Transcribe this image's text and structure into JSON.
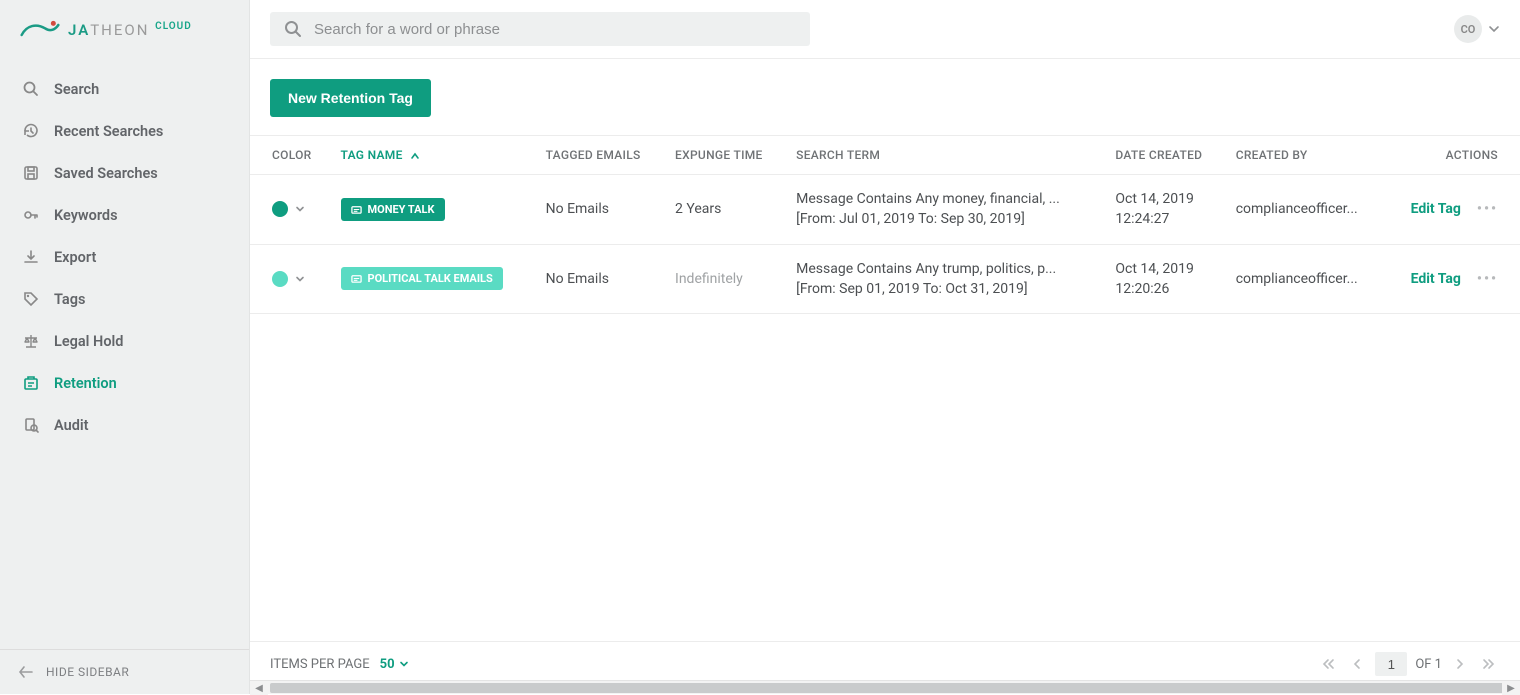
{
  "brand": {
    "name1": "JA",
    "name2": "THEON",
    "cloud": "CLOUD"
  },
  "user": {
    "initials": "CO"
  },
  "search": {
    "placeholder": "Search for a word or phrase"
  },
  "sidebar": {
    "items": [
      {
        "label": "Search",
        "icon": "search"
      },
      {
        "label": "Recent Searches",
        "icon": "history"
      },
      {
        "label": "Saved Searches",
        "icon": "save"
      },
      {
        "label": "Keywords",
        "icon": "key"
      },
      {
        "label": "Export",
        "icon": "download"
      },
      {
        "label": "Tags",
        "icon": "tag"
      },
      {
        "label": "Legal Hold",
        "icon": "balance"
      },
      {
        "label": "Retention",
        "icon": "retention",
        "active": true
      },
      {
        "label": "Audit",
        "icon": "audit"
      }
    ],
    "hide_label": "HIDE SIDEBAR"
  },
  "buttons": {
    "new_tag": "New Retention Tag"
  },
  "table": {
    "headers": {
      "color": "COLOR",
      "tag_name": "TAG NAME",
      "tagged_emails": "TAGGED EMAILS",
      "expunge_time": "EXPUNGE TIME",
      "search_term": "SEARCH TERM",
      "date_created": "DATE CREATED",
      "created_by": "CREATED BY",
      "actions": "ACTIONS"
    },
    "rows": [
      {
        "color": "#0f9d80",
        "tag_label": "MONEY TALK",
        "tag_bg": "#0f9d80",
        "tagged_emails": "No Emails",
        "expunge_time": "2 Years",
        "expunge_muted": false,
        "search_line1": "Message Contains Any money, financial, ...",
        "search_line2": "[From: Jul 01, 2019 To: Sep 30, 2019]",
        "date_line1": "Oct 14, 2019",
        "date_line2": "12:24:27",
        "created_by": "complianceofficer...",
        "edit_label": "Edit Tag"
      },
      {
        "color": "#5adbc3",
        "tag_label": "POLITICAL TALK EMAILS",
        "tag_bg": "#5adbc3",
        "tagged_emails": "No Emails",
        "expunge_time": "Indefinitely",
        "expunge_muted": true,
        "search_line1": "Message Contains Any trump, politics, p...",
        "search_line2": "[From: Sep 01, 2019 To: Oct 31, 2019]",
        "date_line1": "Oct 14, 2019",
        "date_line2": "12:20:26",
        "created_by": "complianceofficer...",
        "edit_label": "Edit Tag"
      }
    ]
  },
  "pagination": {
    "items_label": "ITEMS PER PAGE",
    "items_value": "50",
    "page": "1",
    "of_label": "OF 1"
  }
}
